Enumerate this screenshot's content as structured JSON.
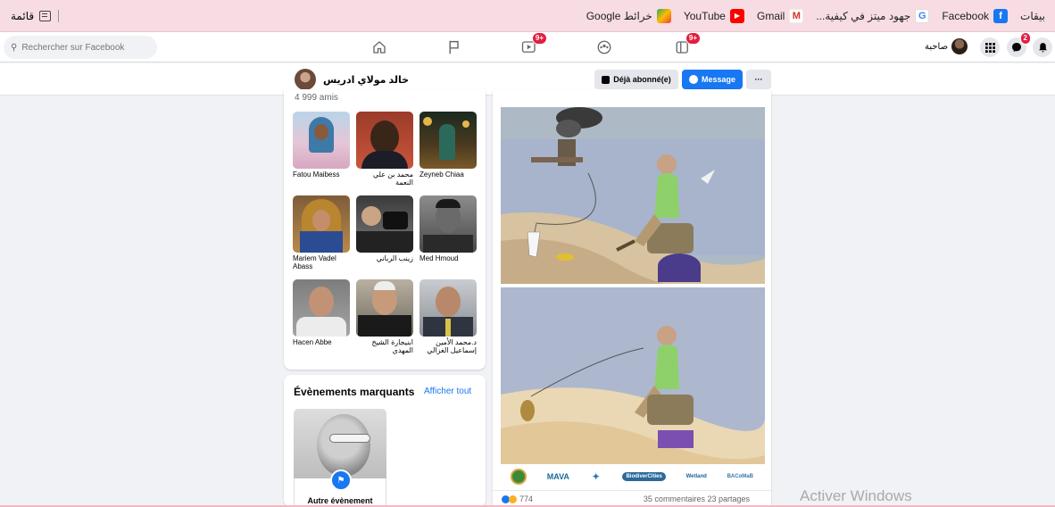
{
  "bookmarks": {
    "items": [
      {
        "label": "بيقات",
        "icon": "apps-icon",
        "color": ""
      },
      {
        "label": "Facebook",
        "icon": "facebook-icon",
        "color": "#1877f2"
      },
      {
        "label": "جهود ميتز في كيفية...",
        "icon": "google-icon",
        "color": "#4285f4"
      },
      {
        "label": "Gmail",
        "icon": "gmail-icon",
        "color": "#d93025"
      },
      {
        "label": "YouTube",
        "icon": "youtube-icon",
        "color": "#ff0000"
      },
      {
        "label": "خرائط Google",
        "icon": "maps-icon",
        "color": "#34a853"
      }
    ],
    "reading_list": "قائمة"
  },
  "fbnav": {
    "search_placeholder": "Rechercher sur Facebook",
    "watch_badge": "9+",
    "groups_badge": "9+",
    "messenger_badge": "2",
    "profile_label": "صاحبة"
  },
  "profile": {
    "name": "خالد مولاي ادريس",
    "subscribed": "Déjà abonné(e)",
    "message": "Message",
    "more": "···"
  },
  "friends": {
    "count": "4 999 amis",
    "list": [
      {
        "name": "Fatou Maibess"
      },
      {
        "name": "محمد بن علي النعمة"
      },
      {
        "name": "Zeyneb Chiaa"
      },
      {
        "name": "Mariem Vadel Abass"
      },
      {
        "name": "زينب الرباني"
      },
      {
        "name": "Med Hmoud"
      },
      {
        "name": "Hacen Abbe"
      },
      {
        "name": "ابنيجارة الشيخ المهدي"
      },
      {
        "name": "د.محمد الأمين إسماعيل الغزالي"
      }
    ]
  },
  "events": {
    "title": "Évènements marquants",
    "link": "Afficher tout",
    "item_label": "Autre évènement"
  },
  "post": {
    "reactions": "774",
    "stats": "35 commentaires  23 partages",
    "logos": [
      "MAVA",
      "BiodiverCities",
      "Wetland",
      "BACoMaB"
    ]
  },
  "system": {
    "watermark": "Activer Windows"
  }
}
